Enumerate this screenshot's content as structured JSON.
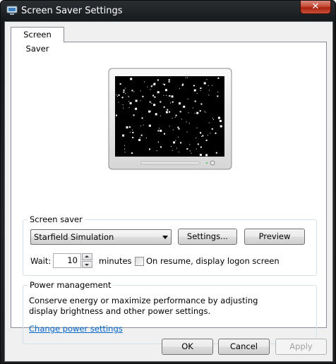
{
  "window": {
    "title": "Screen Saver Settings",
    "close_symbol": "✕",
    "icon": "screen-saver-settings-icon"
  },
  "tabs": [
    {
      "label": "Screen Saver",
      "selected": true
    }
  ],
  "preview": {
    "icon": "monitor-preview",
    "content": "starfield"
  },
  "screen_saver": {
    "group_label": "Screen saver",
    "selected": "Starfield Simulation",
    "settings_label": "Settings...",
    "preview_label": "Preview",
    "wait_label": "Wait:",
    "wait_value": "10",
    "minutes_label": "minutes",
    "resume_label": "On resume, display logon screen",
    "resume_checked": false
  },
  "power": {
    "group_label": "Power management",
    "description": "Conserve energy or maximize performance by adjusting display brightness and other power settings.",
    "link": "Change power settings"
  },
  "footer": {
    "ok": "OK",
    "cancel": "Cancel",
    "apply": "Apply",
    "apply_enabled": false
  },
  "colors": {
    "link": "#0066cc",
    "close_button": "#c54a36",
    "title_text": "#ffffff",
    "client_bg": "#f0f0f0"
  }
}
